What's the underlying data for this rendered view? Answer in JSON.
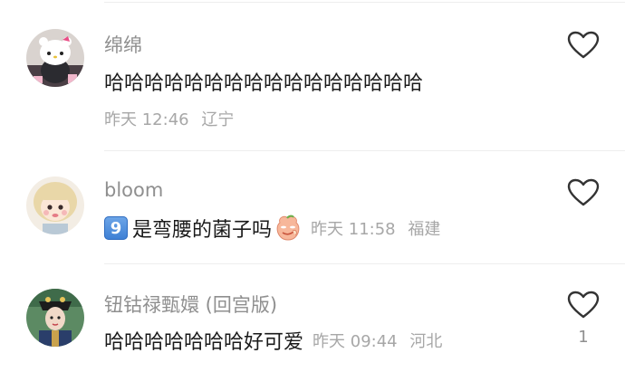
{
  "comments": [
    {
      "username": "绵绵",
      "text": "哈哈哈哈哈哈哈哈哈哈哈哈哈哈哈哈",
      "time": "昨天 12:46",
      "location": "辽宁",
      "avatar": "avatar-hello-kitty"
    },
    {
      "username": "bloom",
      "badge": "9",
      "text": "是弯腰的菌子吗",
      "emoji": "peach-face-emoji",
      "time": "昨天 11:58",
      "location": "福建",
      "avatar": "avatar-doll-girl"
    },
    {
      "username": "钮钴禄甄嬛 (回宫版)",
      "text": "哈哈哈哈哈哈哈好可爱",
      "time": "昨天 09:44",
      "location": "河北",
      "like_count": "1",
      "avatar": "avatar-palace-lady"
    }
  ],
  "colors": {
    "username": "#8f8f8f",
    "text": "#1a1a1a",
    "meta": "#a7a7a7",
    "divider": "#eeeeee",
    "heart_outline": "#333333"
  }
}
